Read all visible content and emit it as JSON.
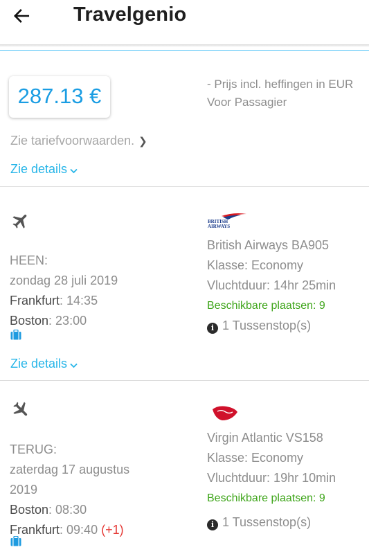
{
  "header": {
    "title": "Travelgenio"
  },
  "price": {
    "amount": "287.13 €",
    "note_line1": "- Prijs incl. heffingen in EUR",
    "note_line2": "Voor Passagier"
  },
  "links": {
    "fare_conditions": "Zie tariefvoorwaarden.",
    "details": "Zie details"
  },
  "outbound": {
    "direction": "HEEN:",
    "date": "zondag 28 juli 2019",
    "departure_city": "Frankfurt",
    "departure_time": ": 14:35",
    "arrival_city": "Boston",
    "arrival_time": ": 23:00",
    "airline_logo_text": "BRITISH AIRWAYS",
    "flight": "British Airways BA905",
    "class": "Klasse: Economy",
    "duration": "Vluchtduur: 14hr 25min",
    "seats": "Beschikbare plaatsen: 9",
    "stops": "1 Tussenstop(s)"
  },
  "return": {
    "direction": "TERUG:",
    "date_line1": "zaterdag 17 augustus",
    "date_line2": "2019",
    "departure_city": "Boston",
    "departure_time": ": 08:30",
    "arrival_city": "Frankfurt",
    "arrival_time": ": 09:40",
    "day_offset": "(+1)",
    "flight": "Virgin Atlantic VS158",
    "class": "Klasse: Economy",
    "duration": "Vluchtduur: 19hr 10min",
    "seats": "Beschikbare plaatsen: 9",
    "stops": "1 Tussenstop(s)"
  },
  "colors": {
    "accent": "#26b5e8",
    "price": "#1a9de3",
    "available": "#3ea51a",
    "day_offset": "#e53935"
  },
  "icons": [
    "arrow-left-icon",
    "chevron-right-icon",
    "chevron-down-icon",
    "airplane-icon",
    "airline-logo",
    "info-icon",
    "luggage-icon"
  ]
}
